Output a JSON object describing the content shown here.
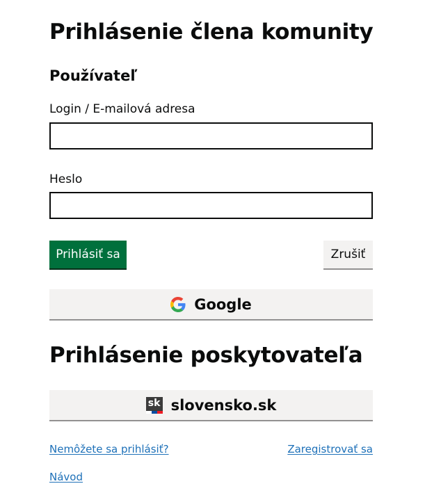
{
  "page": {
    "title": "Prihlásenie člena komunity",
    "section_user": "Používateľ",
    "login_label": "Login / E-mailová adresa",
    "login_value": "",
    "password_label": "Heslo",
    "password_value": "",
    "login_button": "Prihlásiť sa",
    "cancel_button": "Zrušiť",
    "google_button": "Google"
  },
  "provider": {
    "title": "Prihlásenie poskytovateľa",
    "slovensko_button": "slovensko.sk",
    "logo_text": "sk"
  },
  "links": {
    "cant_login": "Nemôžete sa prihlásiť?",
    "register": "Zaregistrovať sa",
    "guide": "Návod"
  },
  "colors": {
    "primary": "#00703c",
    "link": "#1d70b8",
    "secondary_bg": "#f3f2f1",
    "text": "#0b0c0c"
  },
  "icons": {
    "google": "google-g-icon",
    "slovensko": "slovensko-sk-logo-icon"
  }
}
